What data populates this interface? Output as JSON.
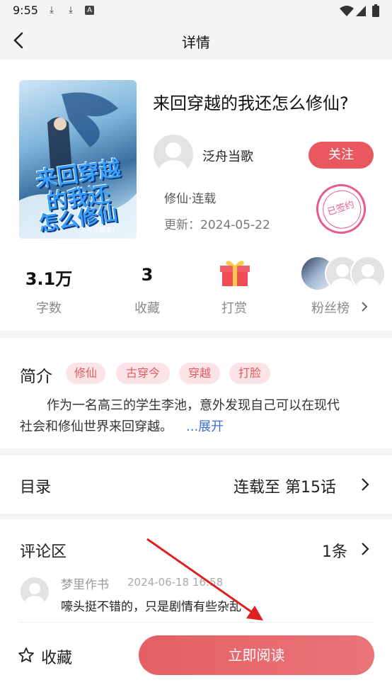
{
  "status_bar": {
    "time": "9:55"
  },
  "header": {
    "title": "详情"
  },
  "book": {
    "title": "来回穿越的我还怎么修仙?",
    "cover_text_1": "来回穿越",
    "cover_text_2": "的我还",
    "cover_text_3": "怎么修仙",
    "cover_small": "泛舟当歌[著]",
    "author": "泛舟当歌",
    "follow_label": "关注",
    "genre_status": "修仙·连载",
    "updated": "更新：2024-05-22",
    "stamp": "已签约"
  },
  "stats": {
    "words_value": "3.1万",
    "words_label": "字数",
    "favorites_value": "3",
    "favorites_label": "收藏",
    "tip_label": "打赏",
    "fans_label": "粉丝榜"
  },
  "intro": {
    "heading": "简介",
    "tags": [
      "修仙",
      "古穿今",
      "穿越",
      "打脸"
    ],
    "text_line1": "作为一名高三的学生李池，意外发现自己可以在现代",
    "text_line2": "社会和修仙世界来回穿越。",
    "expand": "...展开"
  },
  "toc": {
    "heading": "目录",
    "status": "连载至 第15话"
  },
  "comments": {
    "heading": "评论区",
    "count": "1条",
    "items": [
      {
        "user": "梦里作书",
        "time": "2024-06-18 16:58",
        "text": "嚎头挺不错的，只是剧情有些杂乱"
      }
    ]
  },
  "bottom": {
    "favorite_label": "收藏",
    "read_label": "立即阅读"
  },
  "colors": {
    "accent": "#e9585e",
    "tag_bg": "#fbe4e6",
    "link": "#3f6fd6",
    "arrow": "#e02020"
  }
}
